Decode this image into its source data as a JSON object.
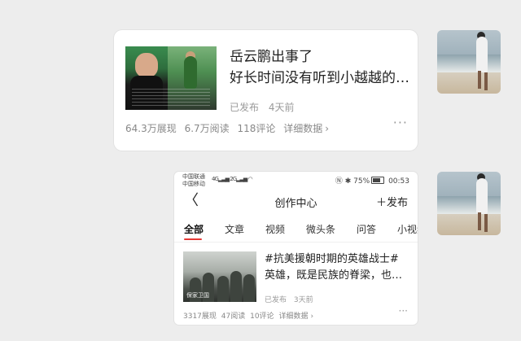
{
  "message1": {
    "title_line1": "岳云鹏出事了",
    "title_line2": "好长时间没有听到小越越的消息了",
    "status": "已发布",
    "time": "4天前",
    "stats": {
      "impressions": "64.3万展现",
      "reads": "6.7万阅读",
      "comments": "118评论",
      "details": "详细数据"
    },
    "more_label": "···"
  },
  "message2": {
    "status_bar": {
      "carrier1": "中国联通",
      "carrier2": "中国移动",
      "net1": "4G",
      "net2": "2G",
      "battery": "75%",
      "time": "00:53"
    },
    "nav": {
      "back": "〈",
      "title": "创作中心",
      "publish": "＋发布"
    },
    "tabs": [
      "全部",
      "文章",
      "视频",
      "微头条",
      "问答",
      "小视频"
    ],
    "active_tab": "全部",
    "article": {
      "title_line1": "#抗美援朝时期的英雄战士#",
      "title_line2": "英雄，既是民族的脊梁，也是一个国家的象征",
      "thumb_caption": "保家卫国",
      "status": "已发布",
      "time": "3天前",
      "stats": {
        "impressions": "3317展现",
        "reads": "47阅读",
        "comments": "10评论",
        "details": "详细数据"
      },
      "more_label": "···"
    }
  },
  "icons": [
    "chevron-right-icon",
    "more-icon",
    "back-icon",
    "plus-icon",
    "battery-icon",
    "wifi-icon"
  ]
}
